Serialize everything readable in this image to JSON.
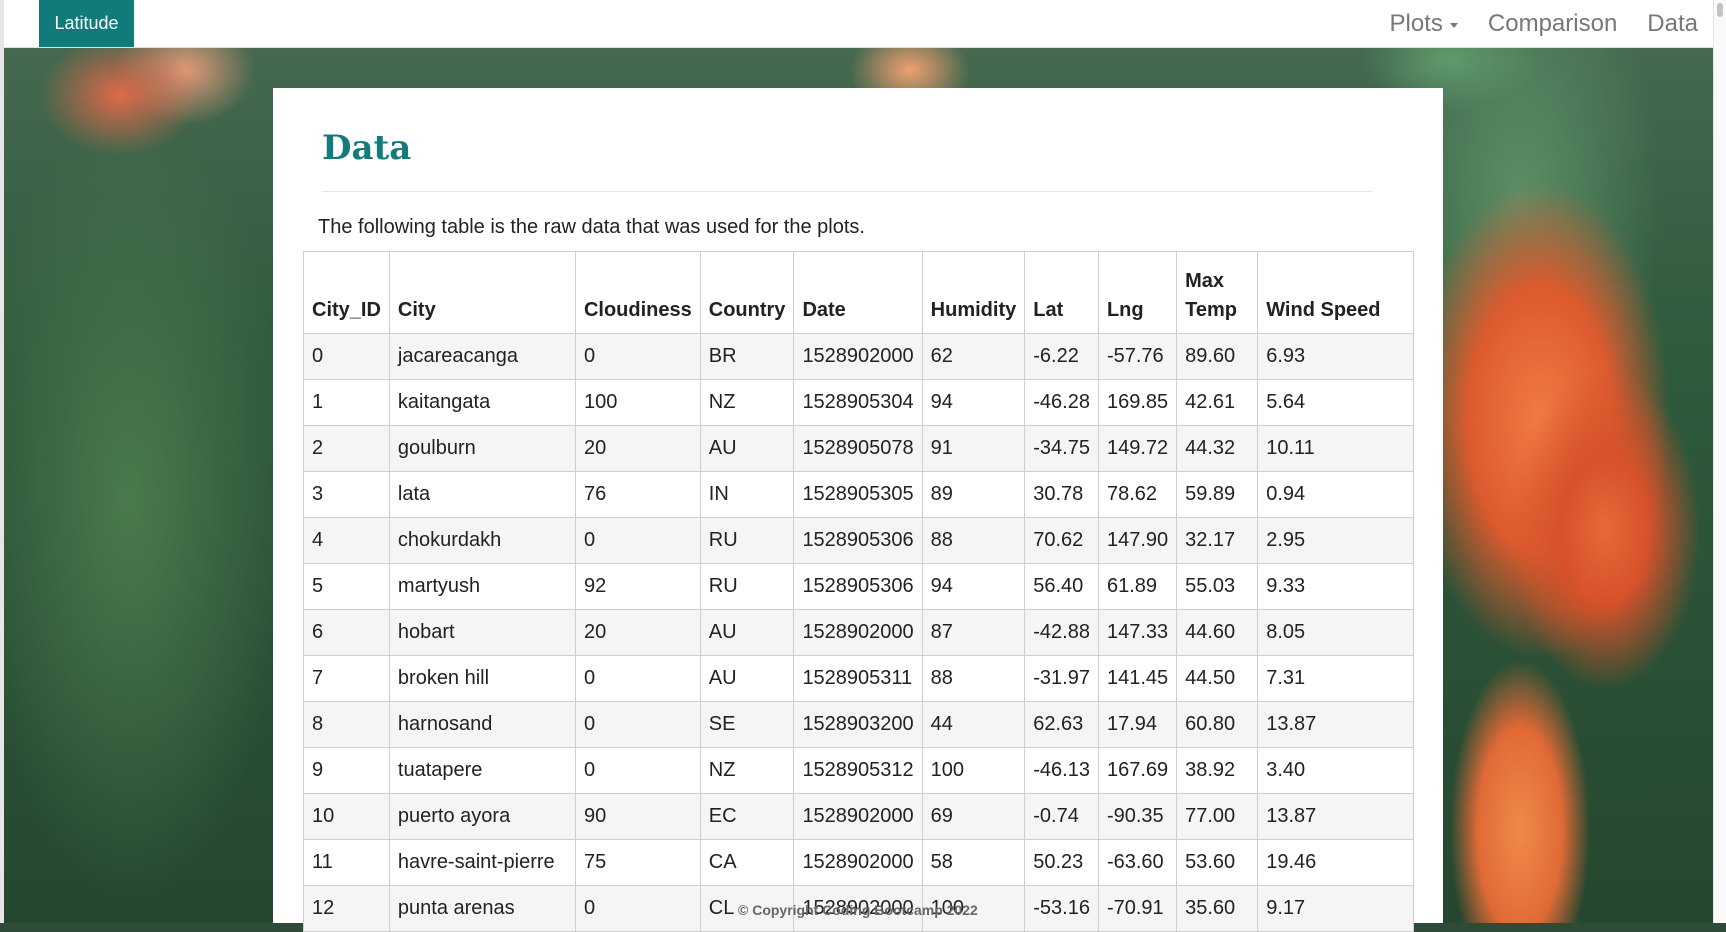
{
  "navbar": {
    "brand": "Latitude",
    "links": {
      "plots": "Plots",
      "comparison": "Comparison",
      "data": "Data"
    }
  },
  "main": {
    "title": "Data",
    "intro": "The following table is the raw data that was used for the plots.",
    "columns": [
      "City_ID",
      "City",
      "Cloudiness",
      "Country",
      "Date",
      "Humidity",
      "Lat",
      "Lng",
      "Max Temp",
      "Wind Speed"
    ],
    "rows": [
      [
        "0",
        "jacareacanga",
        "0",
        "BR",
        "1528902000",
        "62",
        "-6.22",
        "-57.76",
        "89.60",
        "6.93"
      ],
      [
        "1",
        "kaitangata",
        "100",
        "NZ",
        "1528905304",
        "94",
        "-46.28",
        "169.85",
        "42.61",
        "5.64"
      ],
      [
        "2",
        "goulburn",
        "20",
        "AU",
        "1528905078",
        "91",
        "-34.75",
        "149.72",
        "44.32",
        "10.11"
      ],
      [
        "3",
        "lata",
        "76",
        "IN",
        "1528905305",
        "89",
        "30.78",
        "78.62",
        "59.89",
        "0.94"
      ],
      [
        "4",
        "chokurdakh",
        "0",
        "RU",
        "1528905306",
        "88",
        "70.62",
        "147.90",
        "32.17",
        "2.95"
      ],
      [
        "5",
        "martyush",
        "92",
        "RU",
        "1528905306",
        "94",
        "56.40",
        "61.89",
        "55.03",
        "9.33"
      ],
      [
        "6",
        "hobart",
        "20",
        "AU",
        "1528902000",
        "87",
        "-42.88",
        "147.33",
        "44.60",
        "8.05"
      ],
      [
        "7",
        "broken hill",
        "0",
        "AU",
        "1528905311",
        "88",
        "-31.97",
        "141.45",
        "44.50",
        "7.31"
      ],
      [
        "8",
        "harnosand",
        "0",
        "SE",
        "1528903200",
        "44",
        "62.63",
        "17.94",
        "60.80",
        "13.87"
      ],
      [
        "9",
        "tuatapere",
        "0",
        "NZ",
        "1528905312",
        "100",
        "-46.13",
        "167.69",
        "38.92",
        "3.40"
      ],
      [
        "10",
        "puerto ayora",
        "90",
        "EC",
        "1528902000",
        "69",
        "-0.74",
        "-90.35",
        "77.00",
        "13.87"
      ],
      [
        "11",
        "havre-saint-pierre",
        "75",
        "CA",
        "1528902000",
        "58",
        "50.23",
        "-63.60",
        "53.60",
        "19.46"
      ],
      [
        "12",
        "punta arenas",
        "0",
        "CL",
        "1528902000",
        "100",
        "-53.16",
        "-70.91",
        "35.60",
        "9.17"
      ]
    ]
  },
  "footer": {
    "copyright": "© Copyright Coding Bootcamp 2022"
  },
  "colors": {
    "brand": "#117a7a",
    "title": "#137b7b"
  }
}
